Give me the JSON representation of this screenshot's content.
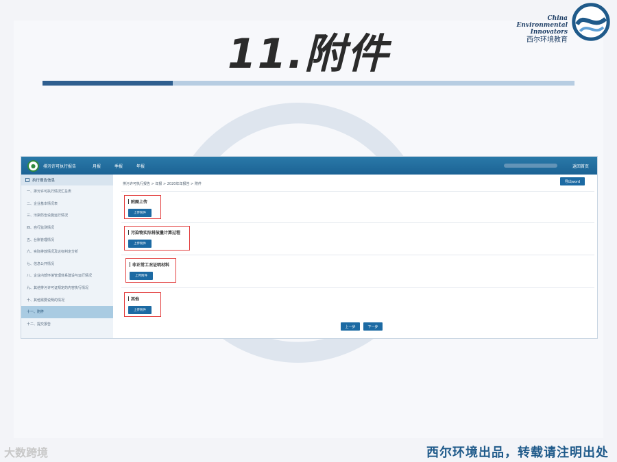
{
  "slide": {
    "title": "11.附件",
    "footer_right": "西尔环境出品，转载请注明出处",
    "footer_left": "大数跨境"
  },
  "brand": {
    "line1": "China",
    "line2": "Environmental",
    "line3": "Innovators",
    "cn": "西尔环境教育"
  },
  "app": {
    "title": "排污许可执行报告",
    "nav": [
      "月报",
      "季报",
      "年报"
    ],
    "home_link": "返回首页",
    "export_label": "导出word",
    "breadcrumb": "排污许可执行报告 > 年报 > 2020年年报告 > 附件",
    "sidebar": {
      "header": "执行报告信息",
      "items": [
        "一、排污许可执行情况汇总表",
        "二、企业基本情况表",
        "三、污染防治设施运行情况",
        "四、自行监测情况",
        "五、台账管理情况",
        "六、实际排放情况及达标判定分析",
        "七、信息公开情况",
        "八、企业内部环境管理体系建设与运行情况",
        "九、其他排污许可证规定的内容执行情况",
        "十、其他需要说明的情况",
        "十一、附件",
        "十二、提交报告"
      ]
    },
    "sections": [
      {
        "label": "附图上传",
        "button": "上传附件"
      },
      {
        "label": "污染物实际排放量计算过程",
        "button": "上传附件"
      },
      {
        "label": "非正常工况证明材料",
        "button": "上传附件"
      },
      {
        "label": "其他",
        "button": "上传附件"
      }
    ],
    "pager": {
      "prev": "上一步",
      "next": "下一步"
    }
  }
}
